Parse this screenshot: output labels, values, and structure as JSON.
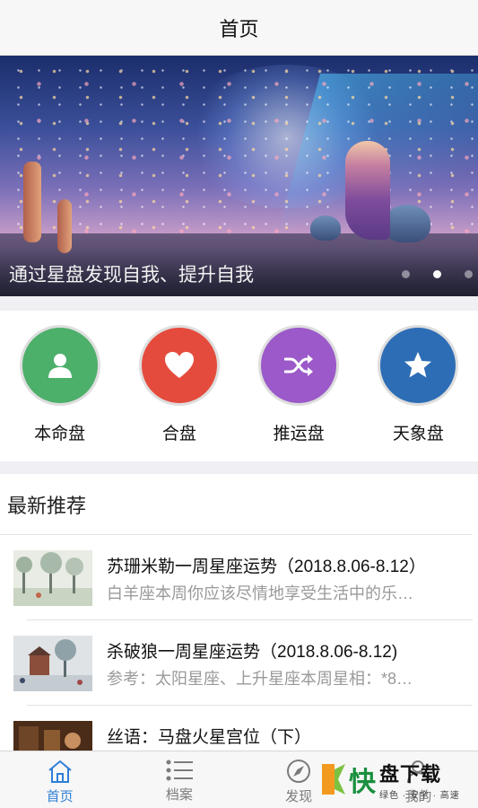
{
  "navbar": {
    "title": "首页"
  },
  "banner": {
    "caption": "通过星盘发现自我、提升自我",
    "slides": 3,
    "active_slide": 2
  },
  "quick_actions": [
    {
      "label": "本命盘",
      "icon": "person-icon",
      "color": "#4caf6a"
    },
    {
      "label": "合盘",
      "icon": "heart-icon",
      "color": "#e54b3c"
    },
    {
      "label": "推运盘",
      "icon": "shuffle-icon",
      "color": "#9b59c9"
    },
    {
      "label": "天象盘",
      "icon": "star-icon",
      "color": "#2d6db5"
    }
  ],
  "recommend": {
    "heading": "最新推荐",
    "items": [
      {
        "title": "苏珊米勒一周星座运势（2018.8.06-8.12）",
        "desc": "白羊座本周你应该尽情地享受生活中的乐…"
      },
      {
        "title": "杀破狼一周星座运势（2018.8.06-8.12)",
        "desc": "参考：太阳星座、上升星座本周星相：*8…"
      },
      {
        "title": "丝语：马盘火星宫位（下）",
        "desc": ""
      }
    ]
  },
  "tabbar": [
    {
      "label": "首页",
      "icon": "home-icon",
      "active": true
    },
    {
      "label": "档案",
      "icon": "list-icon",
      "active": false
    },
    {
      "label": "发现",
      "icon": "compass-icon",
      "active": false
    },
    {
      "label": "我的",
      "icon": "user-icon",
      "active": false
    }
  ],
  "watermark": {
    "brand": "快",
    "title": "盘下载",
    "slogan": "绿色 · 安全 · 高速"
  },
  "colors": {
    "accent": "#2f7fd6"
  }
}
